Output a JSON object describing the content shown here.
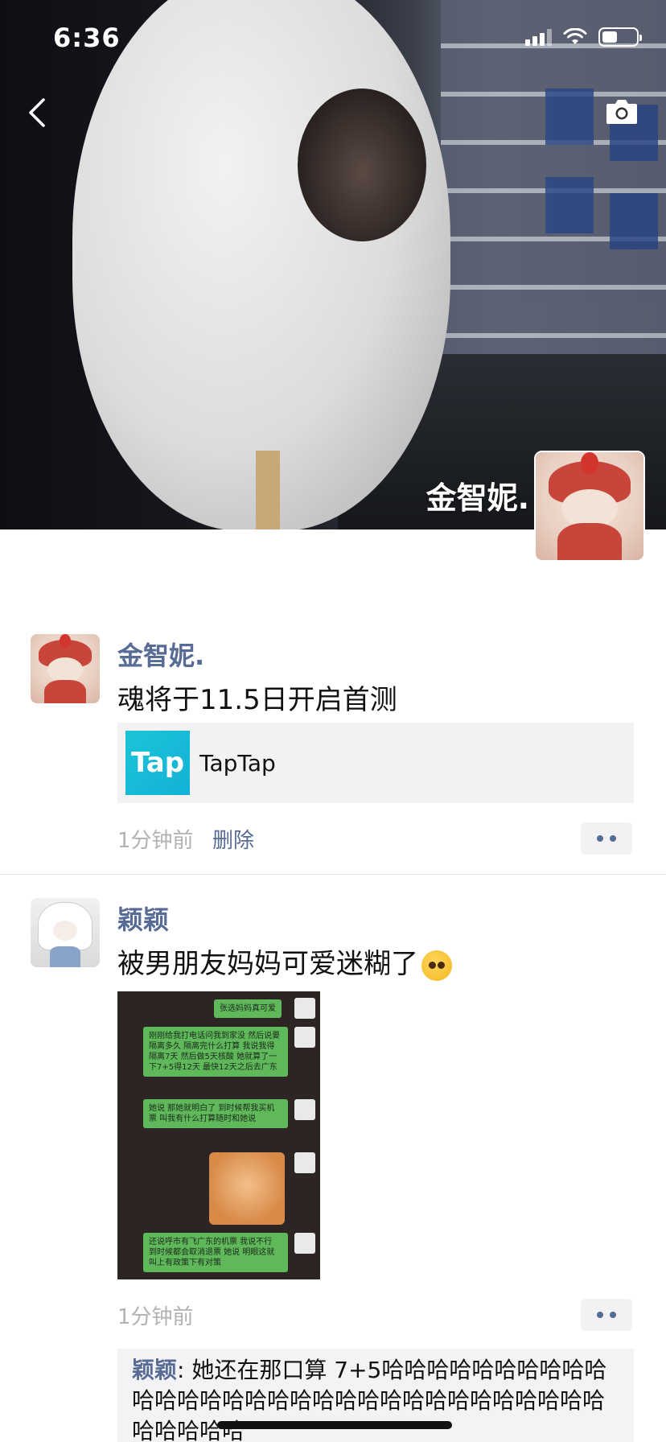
{
  "status_bar": {
    "time": "6:36"
  },
  "cover": {
    "owner_name": "金智妮."
  },
  "posts": [
    {
      "author": "金智妮.",
      "text": "魂将于11.5日开启首测",
      "link": {
        "logo_text": "Tap",
        "title": "TapTap"
      },
      "time": "1分钟前",
      "delete_label": "删除"
    },
    {
      "author": "颖颖",
      "text": "被男朋友妈妈可爱迷糊了",
      "time": "1分钟前",
      "screenshot_bubbles": [
        "张选妈妈真可爱",
        "刚刚给我打电话问我到家没 然后说要隔离多久 隔离完什么打算 我说我得隔离7天 然后做5天核酸 她就算了一下7+5得12天 最快12天之后去广东",
        "她说 那她就明白了 到时候帮我买机票 叫我有什么打算随时和她说",
        "还说呼市有飞广东的机票 我说不行 到时候都会取消退票 她说 明眼这就叫上有政策下有对策"
      ],
      "comment": {
        "author": "颖颖",
        "separator": ": ",
        "text": "她还在那口算 7+5哈哈哈哈哈哈哈哈哈哈哈哈哈哈哈哈哈哈哈哈哈哈哈哈哈哈哈哈哈哈哈哈哈哈哈哈"
      }
    }
  ]
}
